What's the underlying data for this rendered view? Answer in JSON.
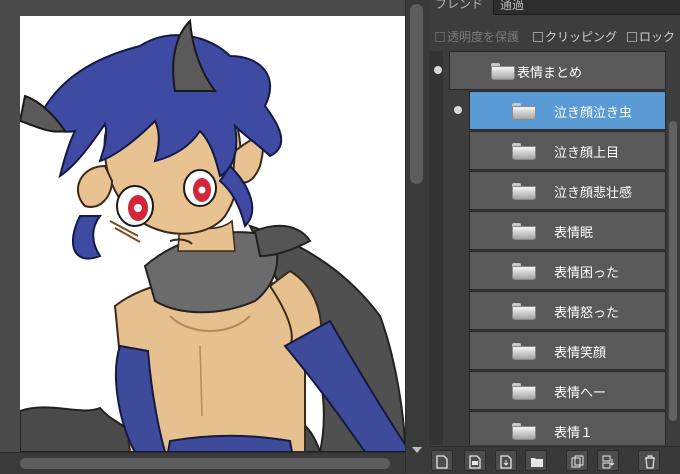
{
  "layer_panel": {
    "blend_label": "ブレンド",
    "blend_mode": "通過",
    "options": {
      "protect_transparency": "透明度を保護",
      "clipping": "クリッピング",
      "lock": "ロック"
    },
    "layers": [
      {
        "name": "表情まとめ",
        "type": "folder",
        "level": 0,
        "visible": true,
        "selected": false
      },
      {
        "name": "泣き顔泣き虫",
        "type": "folder",
        "level": 1,
        "visible": true,
        "selected": true
      },
      {
        "name": "泣き顔上目",
        "type": "folder",
        "level": 1,
        "visible": false,
        "selected": false
      },
      {
        "name": "泣き顔悲壮感",
        "type": "folder",
        "level": 1,
        "visible": false,
        "selected": false
      },
      {
        "name": "表情眠",
        "type": "folder",
        "level": 1,
        "visible": false,
        "selected": false
      },
      {
        "name": "表情困った",
        "type": "folder",
        "level": 1,
        "visible": false,
        "selected": false
      },
      {
        "name": "表情怒った",
        "type": "folder",
        "level": 1,
        "visible": false,
        "selected": false
      },
      {
        "name": "表情笑顔",
        "type": "folder",
        "level": 1,
        "visible": false,
        "selected": false
      },
      {
        "name": "表情へー",
        "type": "folder",
        "level": 1,
        "visible": false,
        "selected": false
      },
      {
        "name": "表情１",
        "type": "folder",
        "level": 1,
        "visible": false,
        "selected": false
      }
    ],
    "toolbar_icons": [
      "new-layer-icon",
      "new-layer-from-file-icon",
      "import-icon",
      "new-folder-icon",
      "duplicate-layer-icon",
      "merge-layer-icon",
      "delete-layer-icon"
    ]
  },
  "colors": {
    "selection": "#5b9bd5",
    "layer_bg": "#595959",
    "panel_bg": "#3d3d3d"
  }
}
